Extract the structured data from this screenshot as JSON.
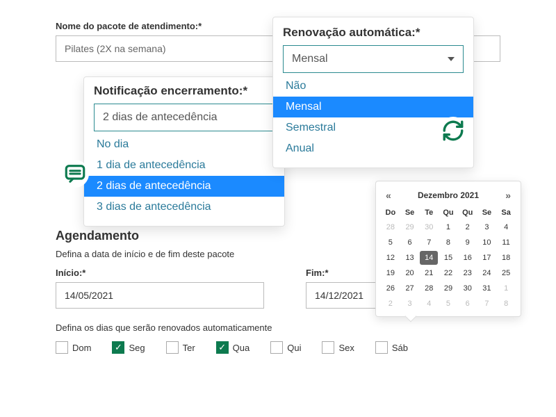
{
  "packageName": {
    "label": "Nome do pacote de atendimento:*",
    "value": "Pilates (2X na semana)"
  },
  "renovacao": {
    "title": "Renovação automática:*",
    "selected": "Mensal",
    "options": [
      "Não",
      "Mensal",
      "Semestral",
      "Anual"
    ],
    "selectedIndex": 1
  },
  "notificacao": {
    "title": "Notificação encerramento:*",
    "selected": "2 dias de antecedência",
    "options": [
      "No dia",
      "1 dia de antecedência",
      "2 dias de antecedência",
      "3 dias de antecedência"
    ],
    "selectedIndex": 2
  },
  "agendamento": {
    "title": "Agendamento",
    "sub": "Defina a data de início e de fim deste pacote",
    "inicio": {
      "label": "Início:*",
      "value": "14/05/2021"
    },
    "fim": {
      "label": "Fim:*",
      "value": "14/12/2021"
    },
    "renewSub": "Defina os dias que serão renovados automaticamente",
    "days": [
      {
        "label": "Dom",
        "checked": false
      },
      {
        "label": "Seg",
        "checked": true
      },
      {
        "label": "Ter",
        "checked": false
      },
      {
        "label": "Qua",
        "checked": true
      },
      {
        "label": "Qui",
        "checked": false
      },
      {
        "label": "Sex",
        "checked": false
      },
      {
        "label": "Sáb",
        "checked": false
      }
    ]
  },
  "calendar": {
    "month": "Dezembro 2021",
    "prev": "«",
    "next": "»",
    "dow": [
      "Do",
      "Se",
      "Te",
      "Qu",
      "Qu",
      "Se",
      "Sa"
    ],
    "grid": [
      {
        "d": 28,
        "o": 1
      },
      {
        "d": 29,
        "o": 1
      },
      {
        "d": 30,
        "o": 1
      },
      {
        "d": 1
      },
      {
        "d": 2
      },
      {
        "d": 3
      },
      {
        "d": 4
      },
      {
        "d": 5
      },
      {
        "d": 6
      },
      {
        "d": 7
      },
      {
        "d": 8
      },
      {
        "d": 9
      },
      {
        "d": 10
      },
      {
        "d": 11
      },
      {
        "d": 12
      },
      {
        "d": 13
      },
      {
        "d": 14,
        "sel": 1
      },
      {
        "d": 15
      },
      {
        "d": 16
      },
      {
        "d": 17
      },
      {
        "d": 18
      },
      {
        "d": 19
      },
      {
        "d": 20
      },
      {
        "d": 21
      },
      {
        "d": 22
      },
      {
        "d": 23
      },
      {
        "d": 24
      },
      {
        "d": 25
      },
      {
        "d": 26
      },
      {
        "d": 27
      },
      {
        "d": 28
      },
      {
        "d": 29
      },
      {
        "d": 30
      },
      {
        "d": 31
      },
      {
        "d": 1,
        "o": 1
      },
      {
        "d": 2,
        "o": 1
      },
      {
        "d": 3,
        "o": 1
      },
      {
        "d": 4,
        "o": 1
      },
      {
        "d": 5,
        "o": 1
      },
      {
        "d": 6,
        "o": 1
      },
      {
        "d": 7,
        "o": 1
      },
      {
        "d": 8,
        "o": 1
      }
    ]
  }
}
